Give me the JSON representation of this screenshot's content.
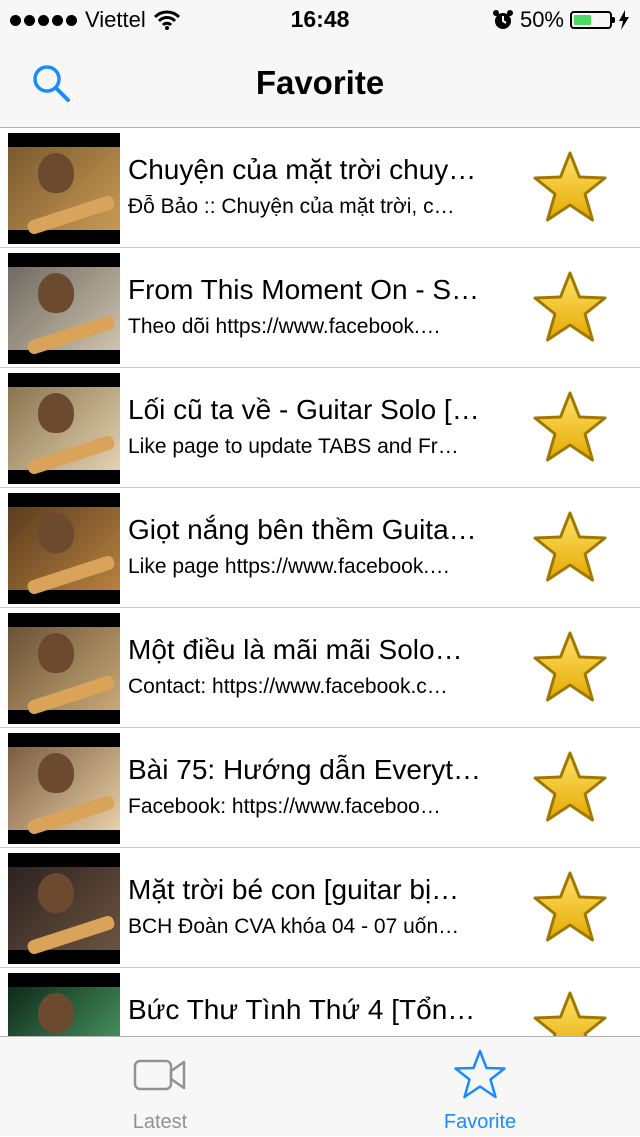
{
  "status_bar": {
    "carrier": "Viettel",
    "time": "16:48",
    "battery_percent": "50%",
    "battery_level": 0.5
  },
  "nav": {
    "title": "Favorite"
  },
  "colors": {
    "accent": "#1a8cff",
    "inactive": "#929292",
    "star_fill": "#f5c518",
    "star_stroke": "#a07800"
  },
  "items": [
    {
      "title": "Chuyện của mặt trời chuy…",
      "subtitle": "Đỗ Bảo :: Chuyện của mặt trời, c…"
    },
    {
      "title": "From This Moment On - S…",
      "subtitle": "Theo dõi https://www.facebook.…"
    },
    {
      "title": "Lối cũ ta về - Guitar Solo […",
      "subtitle": "Like page to update TABS and Fr…"
    },
    {
      "title": "Giọt nắng bên thềm Guita…",
      "subtitle": "Like page https://www.facebook.…"
    },
    {
      "title": "Một điều là mãi mãi Solo…",
      "subtitle": "Contact: https://www.facebook.c…"
    },
    {
      "title": "Bài 75: Hướng dẫn Everyt…",
      "subtitle": "Facebook: https://www.faceboo…"
    },
    {
      "title": "Mặt trời bé con [guitar bị…",
      "subtitle": "BCH Đoàn CVA khóa 04 - 07 uốn…"
    },
    {
      "title": "Bức Thư Tình Thứ 4 [Tổn…",
      "subtitle": ""
    }
  ],
  "tabs": [
    {
      "label": "Latest",
      "icon": "video-camera-icon",
      "active": false
    },
    {
      "label": "Favorite",
      "icon": "star-outline-icon",
      "active": true
    }
  ]
}
